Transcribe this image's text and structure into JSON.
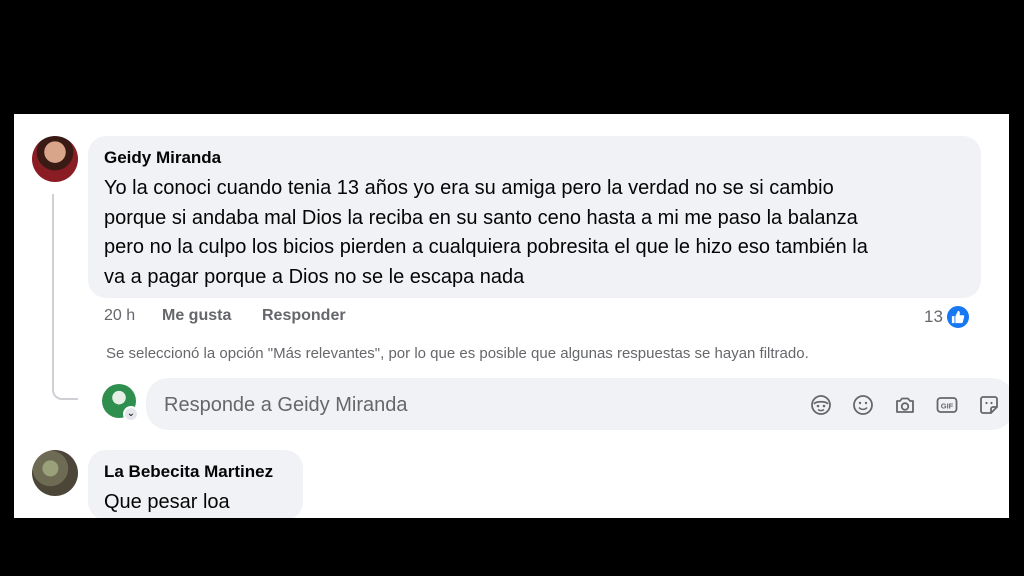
{
  "comments": [
    {
      "author": "Geidy Miranda",
      "lines": [
        "Yo la conoci cuando tenia 13 años yo era su amiga pero la verdad no se si cambio",
        "porque si andaba mal Dios la reciba en su santo ceno hasta a mi me paso la balanza",
        "pero no la culpo los bicios pierden a cualquiera pobresita el que le hizo eso también la",
        "va a pagar porque a Dios no se le escapa nada"
      ],
      "time": "20 h",
      "like_label": "Me gusta",
      "reply_label": "Responder",
      "reaction_count": "13",
      "reaction_icon": "like-icon"
    },
    {
      "author": "La Bebecita Martinez",
      "lines": [
        "Que pesar loa"
      ]
    }
  ],
  "filter_notice": "Se seleccionó la opción \"Más relevantes\", por lo que es posible que algunas respuestas se hayan filtrado.",
  "composer": {
    "placeholder": "Responde a Geidy Miranda",
    "tools": [
      "avatar-sticker-icon",
      "emoji-icon",
      "camera-icon",
      "gif-icon",
      "sticker-icon"
    ]
  },
  "colors": {
    "bubble": "#f0f2f5",
    "accent": "#1877f2",
    "secondary_text": "#65676b"
  }
}
